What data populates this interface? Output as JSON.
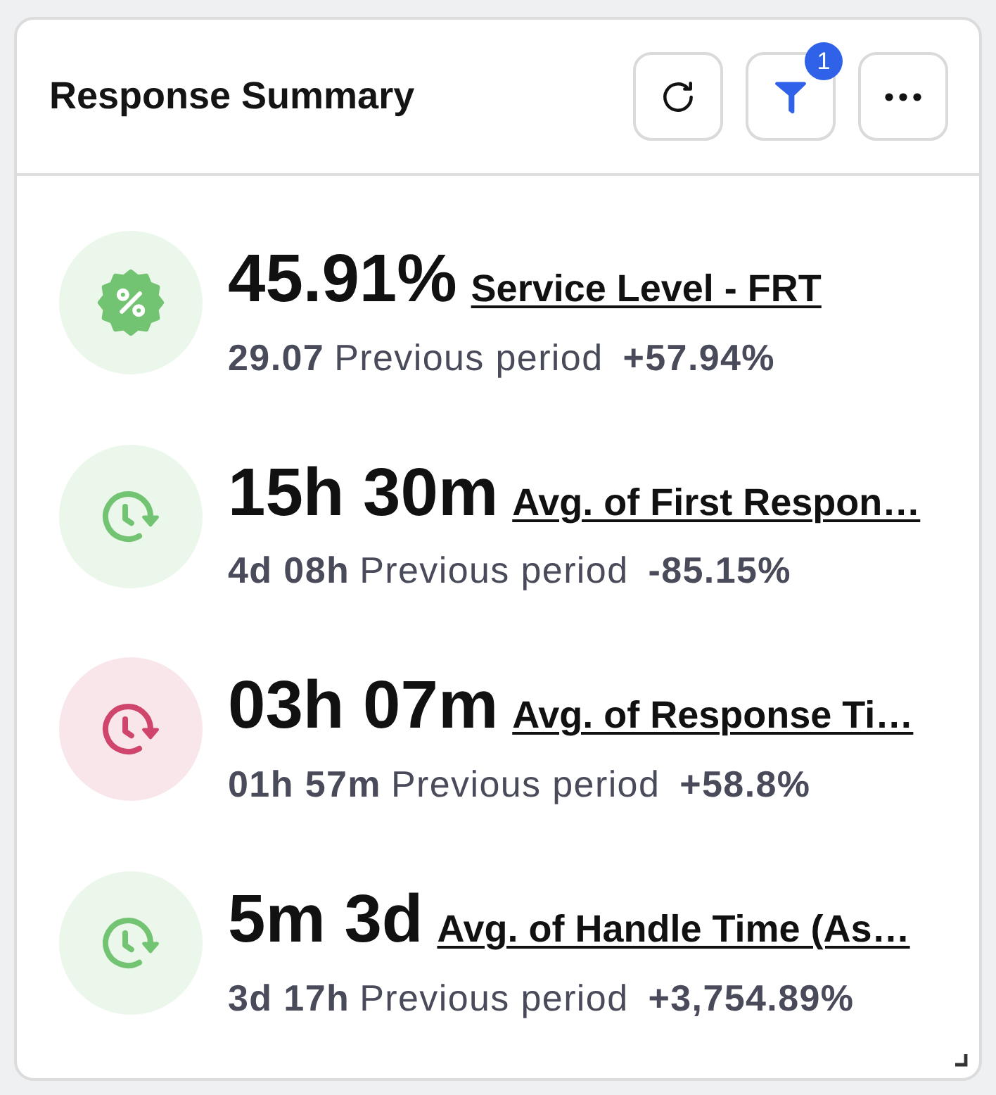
{
  "header": {
    "title": "Response Summary",
    "buttons": [
      {
        "kind": "refresh"
      },
      {
        "kind": "filter",
        "badge": "1"
      },
      {
        "kind": "more"
      }
    ]
  },
  "metrics": [
    {
      "kind": "percent",
      "color": "#72c472",
      "value": "45.91%",
      "title": "Service Level - FRT",
      "previous": "29.07",
      "previous_label": "Previous period",
      "change": "+57.94%"
    },
    {
      "kind": "clock",
      "color": "#72c472",
      "value": "15h 30m",
      "title": "Avg. of First Respon…",
      "previous": "4d 08h",
      "previous_label": "Previous period",
      "change": "-85.15%"
    },
    {
      "kind": "clock",
      "color": "#d0456b",
      "value": "03h 07m",
      "title": "Avg. of Response Ti…",
      "previous": "01h 57m",
      "previous_label": "Previous period",
      "change": "+58.8%"
    },
    {
      "kind": "clock",
      "color": "#72c472",
      "value": "5m 3d",
      "title": "Avg. of Handle Time (As…",
      "previous": "3d 17h",
      "previous_label": "Previous period",
      "change": "+3,754.89%"
    }
  ]
}
